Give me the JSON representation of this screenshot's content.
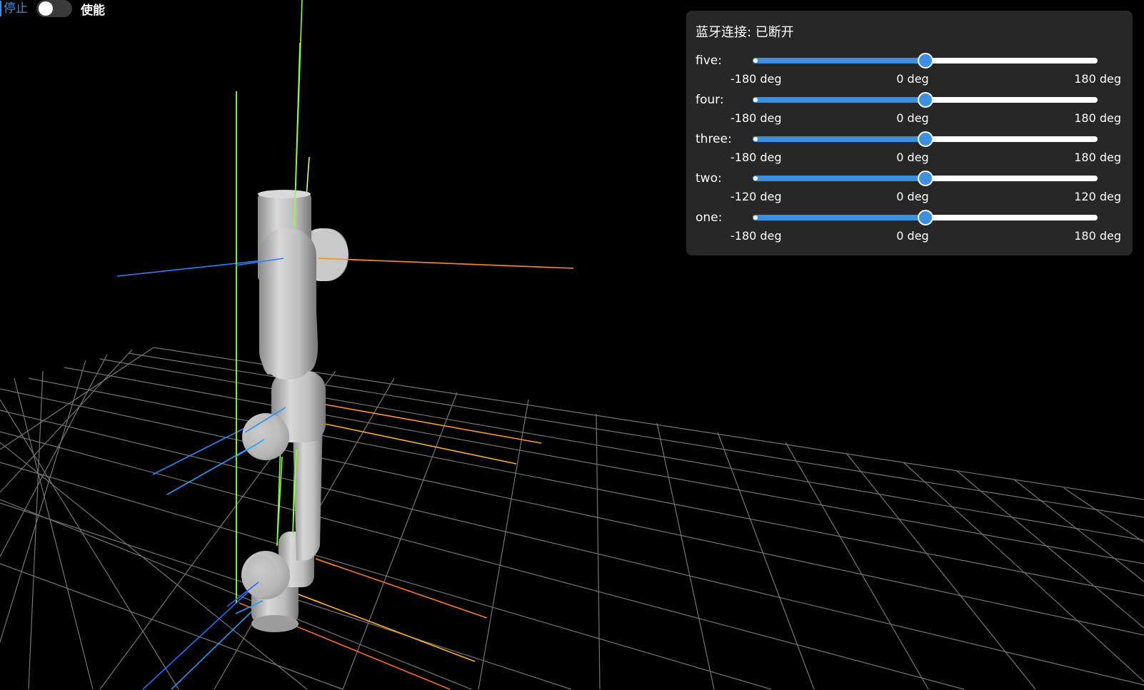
{
  "toolbar": {
    "stop_label": "停止",
    "enable_label": "使能",
    "enable_on": false
  },
  "panel": {
    "title": "蓝牙连接: 已断开",
    "joints": [
      {
        "name": "five:",
        "min_label": "-180 deg",
        "mid_label": "0 deg",
        "max_label": "180 deg",
        "min": -180,
        "max": 180,
        "value": 0
      },
      {
        "name": "four:",
        "min_label": "-180 deg",
        "mid_label": "0 deg",
        "max_label": "180 deg",
        "min": -180,
        "max": 180,
        "value": 0
      },
      {
        "name": "three:",
        "min_label": "-180 deg",
        "mid_label": "0 deg",
        "max_label": "180 deg",
        "min": -180,
        "max": 180,
        "value": 0
      },
      {
        "name": "two:",
        "min_label": "-120 deg",
        "mid_label": "0 deg",
        "max_label": "120 deg",
        "min": -120,
        "max": 120,
        "value": 0
      },
      {
        "name": "one:",
        "min_label": "-180 deg",
        "mid_label": "0 deg",
        "max_label": "180 deg",
        "min": -180,
        "max": 180,
        "value": 0
      }
    ]
  },
  "colors": {
    "accent": "#3d8fe0",
    "panel_bg": "#272727",
    "background": "#000000",
    "grid": "#8a8a8a",
    "axis_x": "#ff7a1a",
    "axis_y": "#8cff3a",
    "axis_z": "#2a7fff",
    "robot": "#c4c4c4"
  }
}
